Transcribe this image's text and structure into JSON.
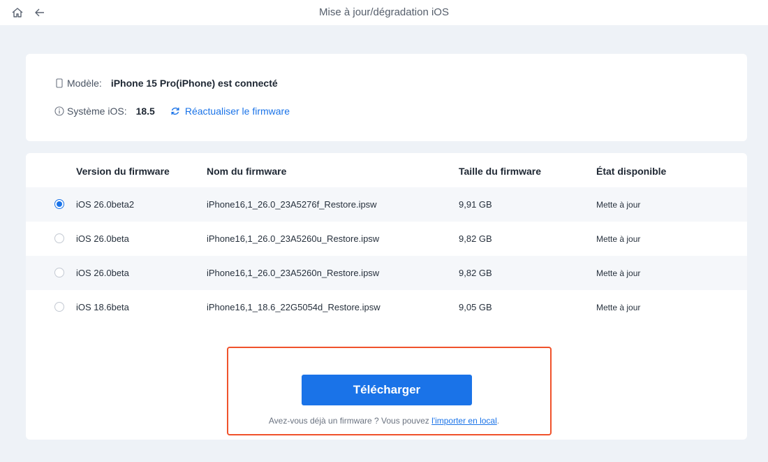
{
  "window": {
    "title": "Mise à jour/dégradation iOS",
    "home_icon": "home-icon",
    "back_icon": "arrow-left-icon"
  },
  "device": {
    "model_label": "Modèle:",
    "model_value": "iPhone 15 Pro(iPhone) est connecté",
    "model_icon": "phone-icon",
    "ios_label": "Système iOS:",
    "ios_value": "18.5",
    "ios_icon": "info-icon",
    "refresh_label": "Réactualiser le firmware",
    "refresh_icon": "refresh-icon"
  },
  "table": {
    "headers": [
      "Version du firmware",
      "Nom du firmware",
      "Taille du firmware",
      "État disponible"
    ],
    "rows": [
      {
        "version": "iOS 26.0beta2",
        "name": "iPhone16,1_26.0_23A5276f_Restore.ipsw",
        "size": "9,91 GB",
        "state": "Mette à jour",
        "selected": true
      },
      {
        "version": "iOS 26.0beta",
        "name": "iPhone16,1_26.0_23A5260u_Restore.ipsw",
        "size": "9,82 GB",
        "state": "Mette à jour",
        "selected": false
      },
      {
        "version": "iOS 26.0beta",
        "name": "iPhone16,1_26.0_23A5260n_Restore.ipsw",
        "size": "9,82 GB",
        "state": "Mette à jour",
        "selected": false
      },
      {
        "version": "iOS 18.6beta",
        "name": "iPhone16,1_18.6_22G5054d_Restore.ipsw",
        "size": "9,05 GB",
        "state": "Mette à jour",
        "selected": false
      }
    ]
  },
  "actions": {
    "download_label": "Télécharger",
    "import_prefix": "Avez-vous déjà un firmware ? Vous pouvez ",
    "import_link": "l'importer en local",
    "import_suffix": "."
  },
  "colors": {
    "accent": "#1a73e8",
    "highlight": "#f0522b",
    "background": "#eef2f7"
  }
}
